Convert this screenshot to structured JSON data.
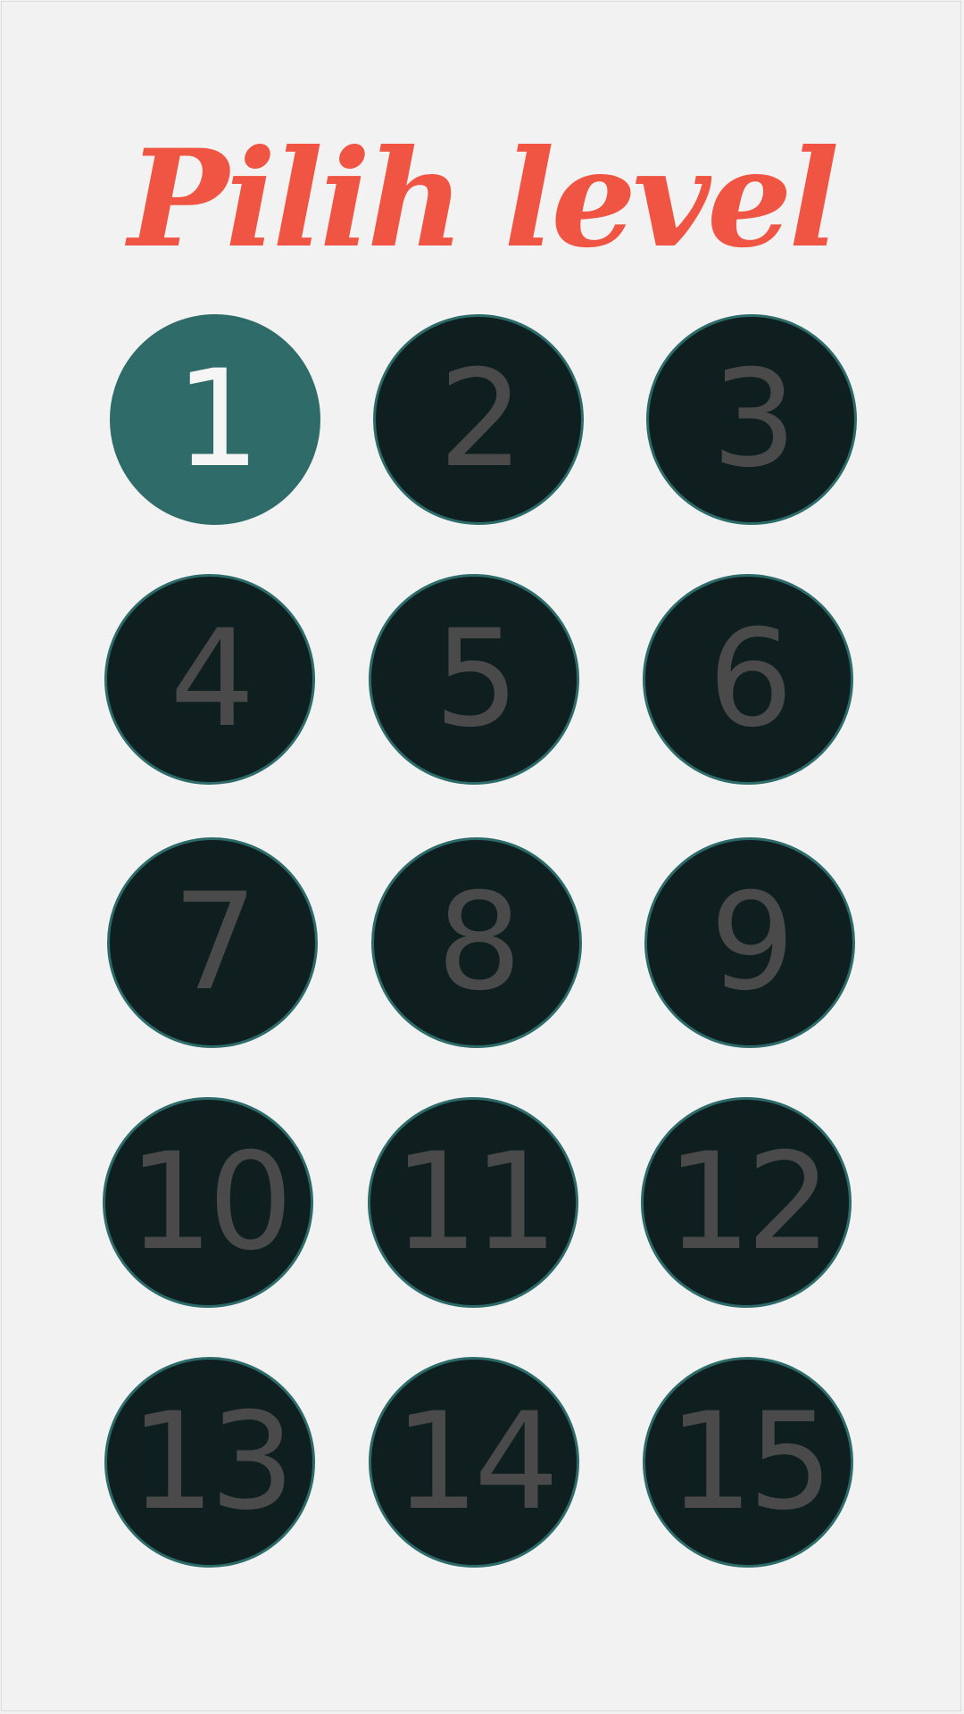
{
  "title": "Pilih level",
  "levels": [
    {
      "label": "1",
      "state": "unlocked"
    },
    {
      "label": "2",
      "state": "locked"
    },
    {
      "label": "3",
      "state": "locked"
    },
    {
      "label": "4",
      "state": "locked"
    },
    {
      "label": "5",
      "state": "locked"
    },
    {
      "label": "6",
      "state": "locked"
    },
    {
      "label": "7",
      "state": "locked"
    },
    {
      "label": "8",
      "state": "locked"
    },
    {
      "label": "9",
      "state": "locked"
    },
    {
      "label": "10",
      "state": "locked"
    },
    {
      "label": "11",
      "state": "locked"
    },
    {
      "label": "12",
      "state": "locked"
    },
    {
      "label": "13",
      "state": "locked"
    },
    {
      "label": "14",
      "state": "locked"
    },
    {
      "label": "15",
      "state": "locked"
    }
  ],
  "colors": {
    "title": "#f05443",
    "unlocked_fill": "#2e6b69",
    "locked_fill": "#0f1f1f",
    "locked_text": "#4a4a4a",
    "unlocked_text": "#f5f5f5",
    "background": "#f2f2f2"
  }
}
